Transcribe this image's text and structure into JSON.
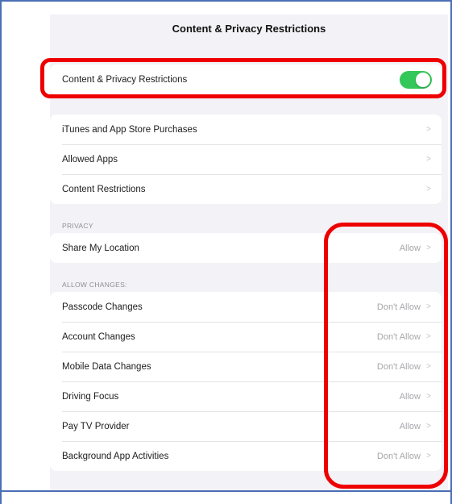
{
  "header": {
    "title": "Content & Privacy Restrictions"
  },
  "master_toggle": {
    "label": "Content & Privacy Restrictions",
    "state": "on",
    "color": "#34c759"
  },
  "store_group": {
    "items": [
      {
        "label": "iTunes and App Store Purchases"
      },
      {
        "label": "Allowed Apps"
      },
      {
        "label": "Content Restrictions"
      }
    ]
  },
  "privacy": {
    "header": "PRIVACY",
    "items": [
      {
        "label": "Share My Location",
        "value": "Allow"
      }
    ]
  },
  "allow_changes": {
    "header": "ALLOW CHANGES:",
    "items": [
      {
        "label": "Passcode Changes",
        "value": "Don't Allow"
      },
      {
        "label": "Account Changes",
        "value": "Don't Allow"
      },
      {
        "label": "Mobile Data Changes",
        "value": "Don't Allow"
      },
      {
        "label": "Driving Focus",
        "value": "Allow"
      },
      {
        "label": "Pay TV Provider",
        "value": "Allow"
      },
      {
        "label": "Background App Activities",
        "value": "Don't Allow"
      }
    ]
  },
  "chevron_glyph": ">",
  "annotation_color": "#ee0000"
}
